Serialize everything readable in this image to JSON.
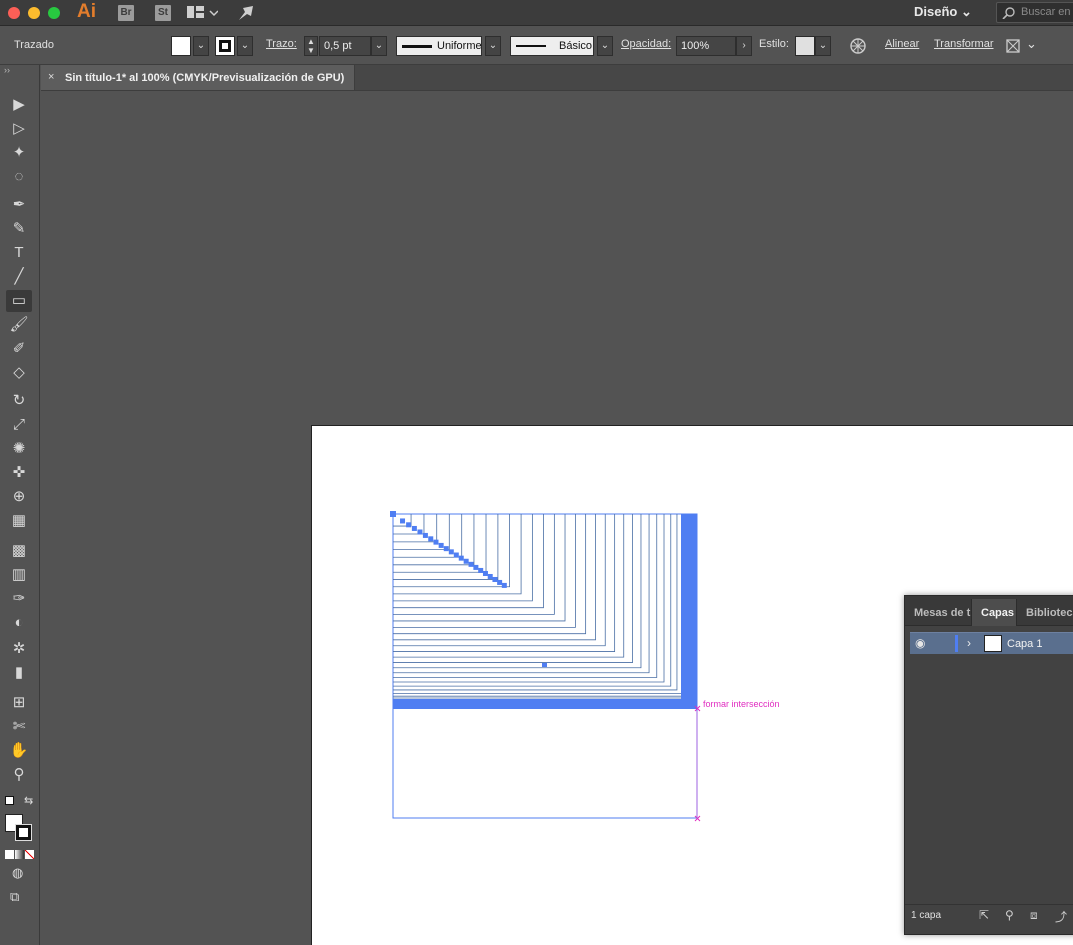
{
  "app": {
    "logo_text": "Ai",
    "bridge_badge": "Br",
    "stock_badge": "St",
    "workspace": "Diseño",
    "search_placeholder": "Buscar en"
  },
  "control_bar": {
    "selection_label": "Trazado",
    "stroke_label": "Trazo:",
    "stroke_weight": "0,5 pt",
    "variable_width_profile": "Uniforme",
    "brush_definition": "Básico",
    "opacity_label": "Opacidad:",
    "opacity_value": "100%",
    "style_label": "Estilo:",
    "align_label": "Alinear",
    "transform_label": "Transformar"
  },
  "document_tab": {
    "close_symbol": "×",
    "title": "Sin título-1* al 100% (CMYK/Previsualización de GPU)"
  },
  "canvas": {
    "smart_guide_label": "formar intersección",
    "colors": {
      "selection": "#4f7ef2",
      "guide": "#e02dc0",
      "path": "#4a6fa5"
    }
  },
  "tools": [
    {
      "name": "selection-tool",
      "glyph": "▶"
    },
    {
      "name": "direct-selection-tool",
      "glyph": "▷"
    },
    {
      "name": "magic-wand-tool",
      "glyph": "✦"
    },
    {
      "name": "lasso-tool",
      "glyph": "◌"
    },
    {
      "name": "pen-tool",
      "glyph": "✒"
    },
    {
      "name": "curvature-tool",
      "glyph": "✎"
    },
    {
      "name": "type-tool",
      "glyph": "T"
    },
    {
      "name": "line-tool",
      "glyph": "╱"
    },
    {
      "name": "rectangle-tool",
      "glyph": "▭"
    },
    {
      "name": "paintbrush-tool",
      "glyph": "🖌"
    },
    {
      "name": "shaper-tool",
      "glyph": "✐"
    },
    {
      "name": "eraser-tool",
      "glyph": "◇"
    },
    {
      "name": "rotate-tool",
      "glyph": "↻"
    },
    {
      "name": "scale-tool",
      "glyph": "⤢"
    },
    {
      "name": "warp-tool",
      "glyph": "✺"
    },
    {
      "name": "puppet-warp-tool",
      "glyph": "✜"
    },
    {
      "name": "shape-builder-tool",
      "glyph": "⊕"
    },
    {
      "name": "perspective-grid-tool",
      "glyph": "▦"
    },
    {
      "name": "mesh-tool",
      "glyph": "▩"
    },
    {
      "name": "gradient-tool",
      "glyph": "▥"
    },
    {
      "name": "eyedropper-tool",
      "glyph": "✑"
    },
    {
      "name": "blend-tool",
      "glyph": "◐"
    },
    {
      "name": "symbol-sprayer-tool",
      "glyph": "✲"
    },
    {
      "name": "column-graph-tool",
      "glyph": "▮"
    },
    {
      "name": "artboard-tool",
      "glyph": "⊞"
    },
    {
      "name": "slice-tool",
      "glyph": "✄"
    },
    {
      "name": "hand-tool",
      "glyph": "✋"
    },
    {
      "name": "zoom-tool",
      "glyph": "⚲"
    }
  ],
  "layers_panel": {
    "tabs": [
      "Mesas de t",
      "Capas",
      "Biblioteca"
    ],
    "active_tab": "Capas",
    "layers": [
      {
        "name": "Capa 1",
        "color": "#4f7ef2"
      }
    ],
    "count_label": "1 capa"
  }
}
